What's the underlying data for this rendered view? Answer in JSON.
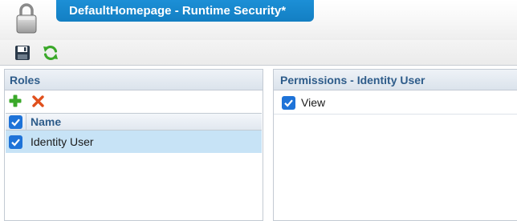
{
  "header": {
    "title": "DefaultHomepage - Runtime Security*",
    "icon": "padlock-icon"
  },
  "toolbar": {
    "save_icon": "floppy-disk-icon",
    "refresh_icon": "refresh-icon"
  },
  "roles": {
    "title": "Roles",
    "add_icon": "plus-icon",
    "delete_icon": "close-icon",
    "columns": [
      "Name"
    ],
    "header_checked": true,
    "rows": [
      {
        "name": "Identity User",
        "checked": true,
        "selected": true
      }
    ]
  },
  "permissions": {
    "title": "Permissions - Identity User",
    "items": [
      {
        "label": "View",
        "checked": true
      }
    ]
  },
  "colors": {
    "title_tab": "#1581c8",
    "panel_title": "#2e5c8a",
    "checkbox": "#1e73d8",
    "selected_row": "#c7e3f6",
    "add_green": "#3aa829",
    "delete_orange": "#e0501d"
  }
}
